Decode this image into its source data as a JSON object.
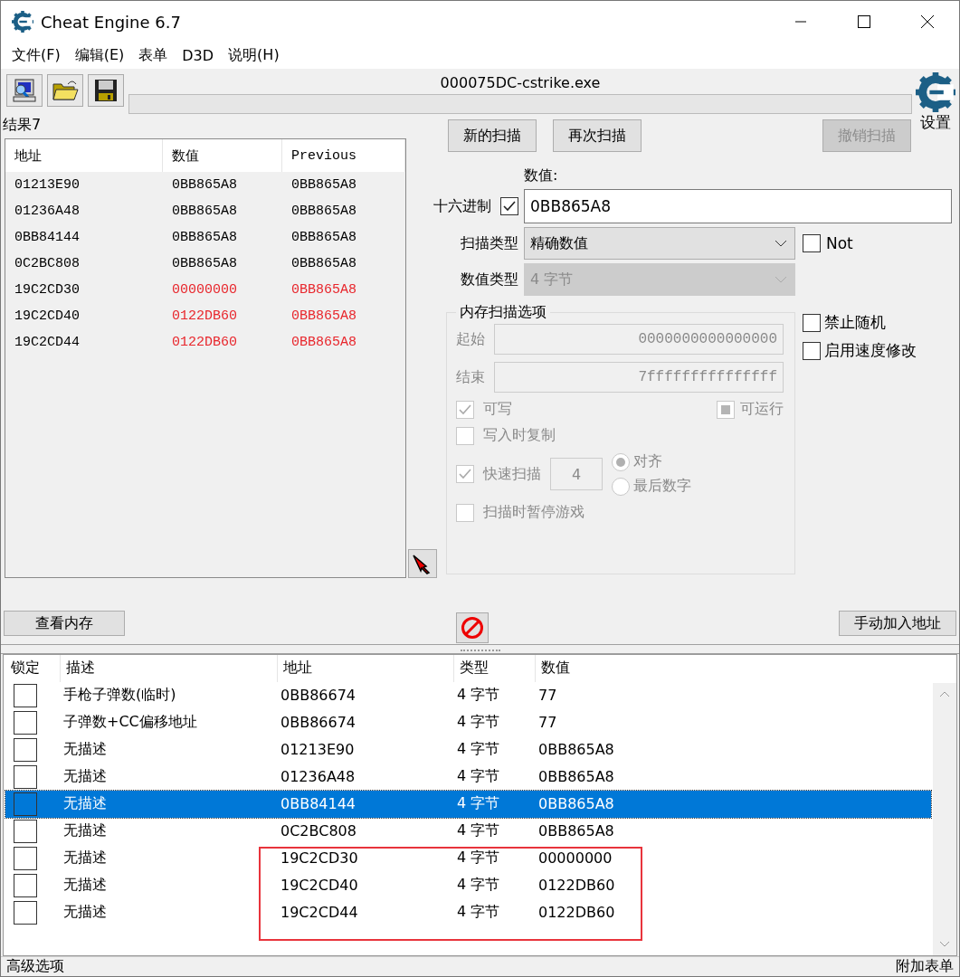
{
  "window": {
    "title": "Cheat Engine 6.7"
  },
  "menu": [
    "文件(F)",
    "编辑(E)",
    "表单",
    "D3D",
    "说明(H)"
  ],
  "process": "000075DC-cstrike.exe",
  "settings_label": "设置",
  "results_count": "结果7",
  "results": {
    "columns": [
      "地址",
      "数值",
      "Previous"
    ],
    "rows": [
      {
        "address": "01213E90",
        "value": "0BB865A8",
        "previous": "0BB865A8",
        "changed": false
      },
      {
        "address": "01236A48",
        "value": "0BB865A8",
        "previous": "0BB865A8",
        "changed": false
      },
      {
        "address": "0BB84144",
        "value": "0BB865A8",
        "previous": "0BB865A8",
        "changed": false
      },
      {
        "address": "0C2BC808",
        "value": "0BB865A8",
        "previous": "0BB865A8",
        "changed": false
      },
      {
        "address": "19C2CD30",
        "value": "00000000",
        "previous": "0BB865A8",
        "changed": true
      },
      {
        "address": "19C2CD40",
        "value": "0122DB60",
        "previous": "0BB865A8",
        "changed": true
      },
      {
        "address": "19C2CD44",
        "value": "0122DB60",
        "previous": "0BB865A8",
        "changed": true
      }
    ]
  },
  "scan_buttons": [
    {
      "label": "新的扫描",
      "disabled": false
    },
    {
      "label": "再次扫描",
      "disabled": false
    },
    {
      "label": "撤销扫描",
      "disabled": true
    }
  ],
  "value": {
    "label": "数值:",
    "hex_label": "十六进制",
    "hex_checked": true,
    "value": "0BB865A8"
  },
  "scan_type": {
    "label": "扫描类型",
    "value": "精确数值",
    "disabled": false
  },
  "value_type": {
    "label": "数值类型",
    "value": "4 字节",
    "disabled": true
  },
  "not": {
    "label": "Not",
    "checked": false
  },
  "memory_options": {
    "title": "内存扫描选项",
    "disabled": true,
    "start_label": "起始",
    "start": "0000000000000000",
    "stop_label": "结束",
    "stop": "7fffffffffffffff",
    "writable": {
      "label": "可写",
      "checked": true
    },
    "executable": {
      "label": "可运行",
      "indeterminate": true
    },
    "copy_on_write": {
      "label": "写入时复制",
      "checked": false
    },
    "fast_scan": {
      "label": "快速扫描",
      "checked": true,
      "value": "4"
    },
    "alignment": [
      {
        "label": "对齐",
        "selected": true
      },
      {
        "label": "最后数字",
        "selected": false
      }
    ],
    "pause": {
      "label": "扫描时暂停游戏",
      "checked": false
    }
  },
  "options": [
    {
      "label": "禁止随机",
      "checked": false
    },
    {
      "label": "启用速度修改",
      "checked": false
    }
  ],
  "view_memory": "查看内存",
  "add_address": "手动加入地址",
  "cheat_table": {
    "columns": [
      "锁定",
      "描述",
      "地址",
      "类型",
      "数值"
    ],
    "rows": [
      {
        "locked": false,
        "selected": false,
        "outlined": false,
        "description": "手枪子弹数(临时)",
        "address": "0BB86674",
        "type": "4 字节",
        "value": "77"
      },
      {
        "locked": false,
        "selected": false,
        "outlined": false,
        "description": "子弹数+CC偏移地址",
        "address": "0BB86674",
        "type": "4 字节",
        "value": "77"
      },
      {
        "locked": false,
        "selected": false,
        "outlined": false,
        "description": "无描述",
        "address": "01213E90",
        "type": "4 字节",
        "value": "0BB865A8"
      },
      {
        "locked": false,
        "selected": false,
        "outlined": false,
        "description": "无描述",
        "address": "01236A48",
        "type": "4 字节",
        "value": "0BB865A8"
      },
      {
        "locked": false,
        "selected": true,
        "outlined": false,
        "description": "无描述",
        "address": "0BB84144",
        "type": "4 字节",
        "value": "0BB865A8"
      },
      {
        "locked": false,
        "selected": false,
        "outlined": false,
        "description": "无描述",
        "address": "0C2BC808",
        "type": "4 字节",
        "value": "0BB865A8"
      },
      {
        "locked": false,
        "selected": false,
        "outlined": true,
        "description": "无描述",
        "address": "19C2CD30",
        "type": "4 字节",
        "value": "00000000"
      },
      {
        "locked": false,
        "selected": false,
        "outlined": true,
        "description": "无描述",
        "address": "19C2CD40",
        "type": "4 字节",
        "value": "0122DB60"
      },
      {
        "locked": false,
        "selected": false,
        "outlined": true,
        "description": "无描述",
        "address": "19C2CD44",
        "type": "4 字节",
        "value": "0122DB60"
      }
    ]
  },
  "status_bar": {
    "left": "高级选项",
    "right": "附加表单"
  }
}
